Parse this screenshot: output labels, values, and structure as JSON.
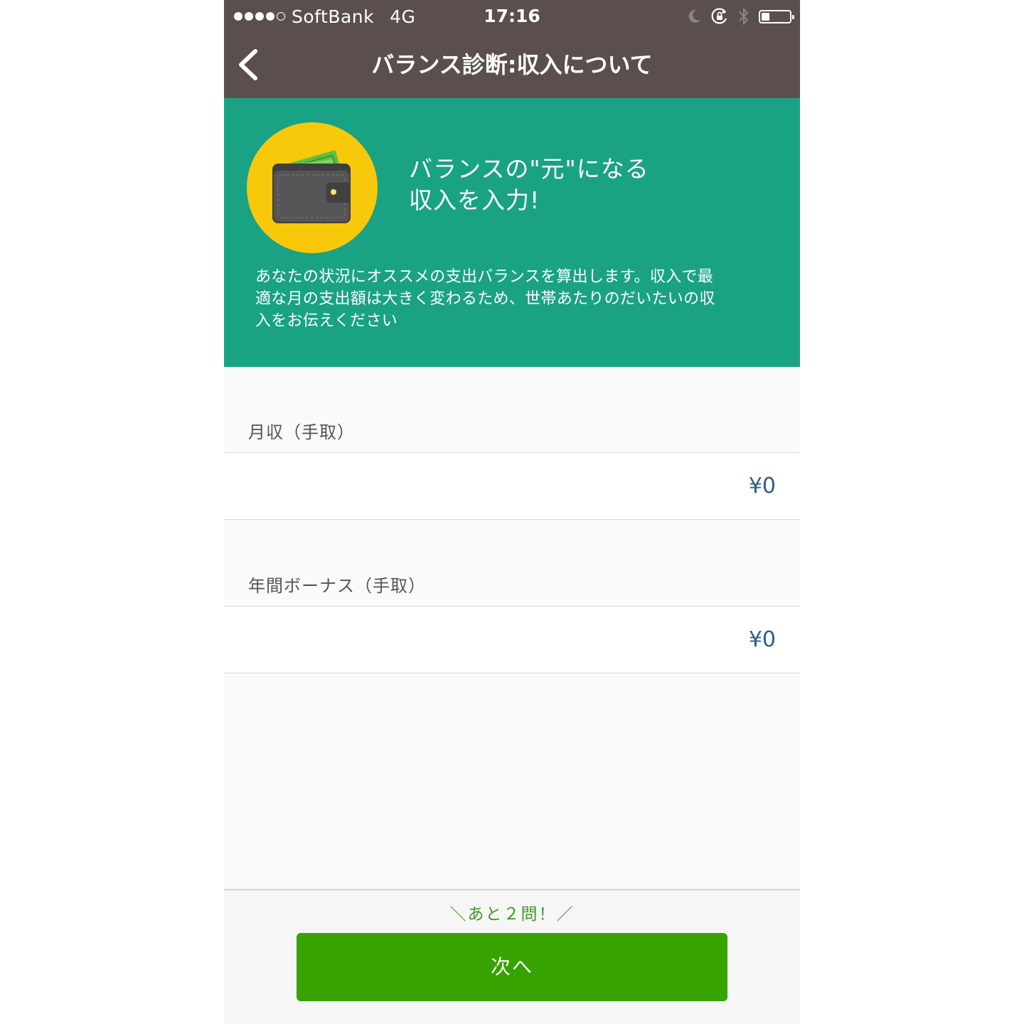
{
  "status_bar": {
    "carrier": "SoftBank",
    "network": "4G",
    "time": "17:16",
    "signal_bars_filled": 4,
    "signal_bars_total": 5,
    "battery_level": 0.3
  },
  "nav": {
    "title": "バランス診断:収入について",
    "back_icon": "chevron-left-icon"
  },
  "hero": {
    "icon": "wallet-icon",
    "headline_line1": "バランスの\"元\"になる",
    "headline_line2": "収入を入力!",
    "description_line1": "あなたの状況にオススメの支出バランスを算出します。収入で最",
    "description_line2": "適な月の支出額は大きく変わるため、世帯あたりのだいたいの収",
    "description_line3": "入をお伝えください"
  },
  "form": {
    "monthly_income": {
      "label": "月収（手取）",
      "value": "¥0"
    },
    "annual_bonus": {
      "label": "年間ボーナス（手取）",
      "value": "¥0"
    }
  },
  "footer": {
    "remaining": "＼あと２問！／",
    "next_label": "次へ"
  },
  "colors": {
    "nav_bg": "#5a4f4d",
    "hero_bg": "#1aa285",
    "icon_circle": "#f7c90a",
    "value_text": "#2d5e8e",
    "button_bg": "#37a300",
    "remaining_text": "#3a9d22"
  }
}
